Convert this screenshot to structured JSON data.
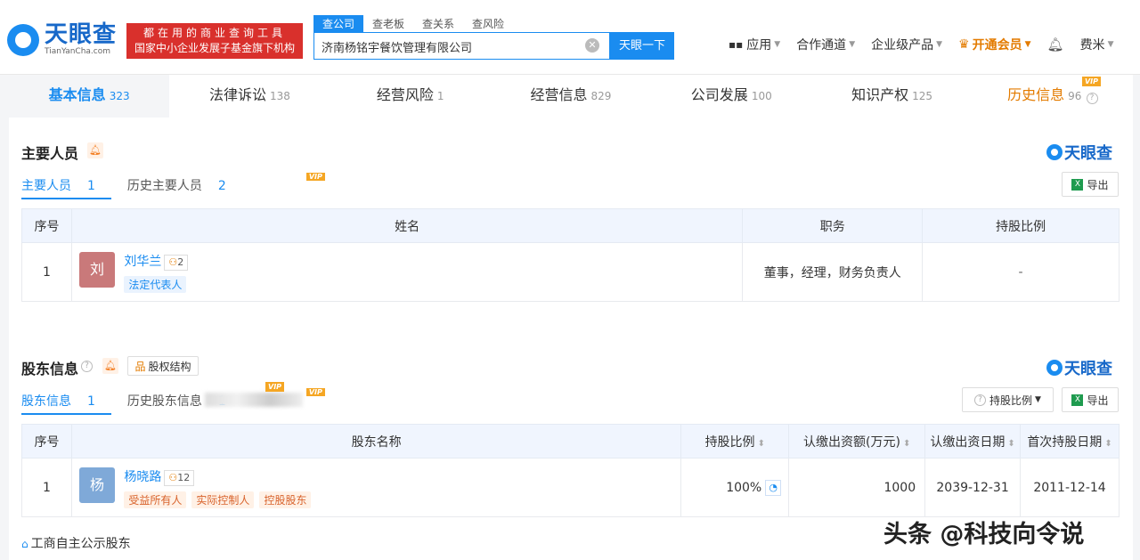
{
  "header": {
    "logo_cn": "天眼查",
    "logo_en": "TianYanCha.com",
    "slogan_line1": "都在用的商业查询工具",
    "slogan_line2": "国家中小企业发展子基金旗下机构",
    "search_tabs": [
      "查公司",
      "查老板",
      "查关系",
      "查风险"
    ],
    "search_value": "济南杨铭宇餐饮管理有限公司",
    "search_button": "天眼一下",
    "nav": [
      "应用",
      "合作通道",
      "企业级产品",
      "开通会员",
      "费米"
    ]
  },
  "tabs": [
    {
      "label": "基本信息",
      "count": "323"
    },
    {
      "label": "法律诉讼",
      "count": "138"
    },
    {
      "label": "经营风险",
      "count": "1"
    },
    {
      "label": "经营信息",
      "count": "829"
    },
    {
      "label": "公司发展",
      "count": "100"
    },
    {
      "label": "知识产权",
      "count": "125"
    },
    {
      "label": "历史信息",
      "count": "96"
    }
  ],
  "vip_label": "VIP",
  "personnel": {
    "title": "主要人员",
    "brand": "天眼查",
    "subtab_current": "主要人员",
    "subtab_current_count": "1",
    "subtab_history": "历史主要人员",
    "subtab_history_count": "2",
    "export": "导出",
    "headers": [
      "序号",
      "姓名",
      "职务",
      "持股比例"
    ],
    "rows": [
      {
        "index": "1",
        "avatar": "刘",
        "name": "刘华兰",
        "relations": "2",
        "tag": "法定代表人",
        "position": "董事，经理，财务负责人",
        "ratio": "-"
      }
    ]
  },
  "shareholders": {
    "title": "股东信息",
    "brand": "天眼查",
    "equity_btn": "股权结构",
    "subtab_current": "股东信息",
    "subtab_current_count": "1",
    "subtab_history": "历史股东信息",
    "subtab_history_count": "1",
    "ratio_filter": "持股比例",
    "export": "导出",
    "headers": [
      "序号",
      "股东名称",
      "持股比例",
      "认缴出资额(万元)",
      "认缴出资日期",
      "首次持股日期"
    ],
    "rows": [
      {
        "index": "1",
        "avatar": "杨",
        "name": "杨晓路",
        "relations": "12",
        "tags": [
          "受益所有人",
          "实际控制人",
          "控股股东"
        ],
        "ratio": "100%",
        "amount": "1000",
        "date": "2039-12-31",
        "first_date": "2011-12-14"
      }
    ],
    "footer_link": "工商自主公示股东"
  },
  "watermark": "头条 @科技向令说"
}
